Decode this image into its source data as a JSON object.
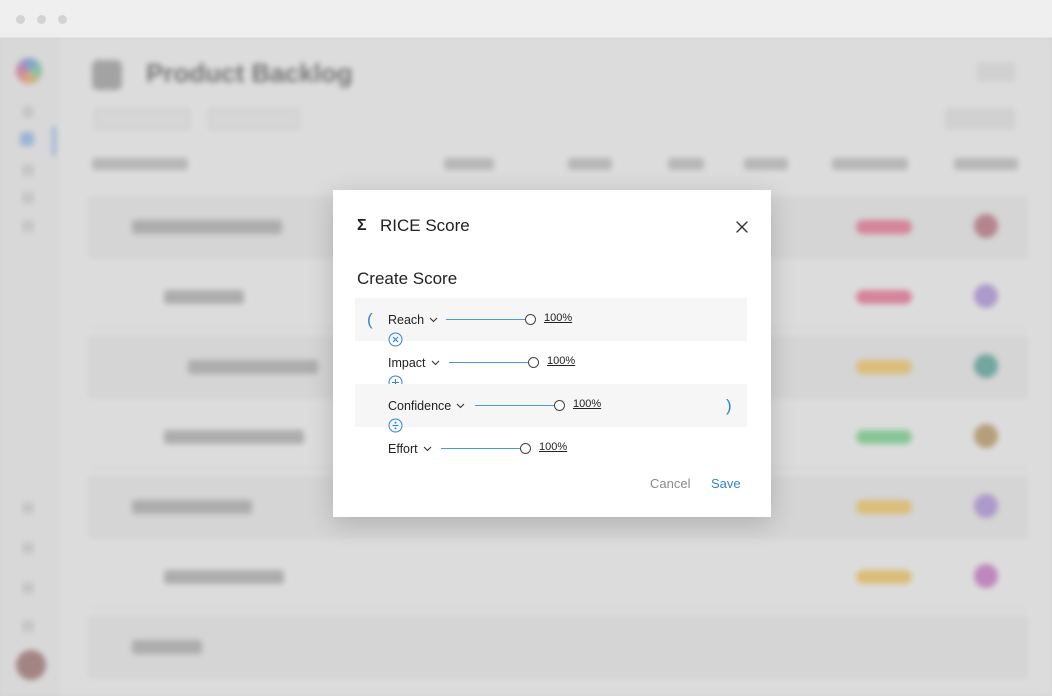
{
  "window": {
    "controls": [
      "close",
      "minimize",
      "maximize"
    ]
  },
  "background": {
    "page_title": "Product Backlog",
    "tag_colors": [
      "#e56b8c",
      "#e56b8c",
      "#efc25a",
      "#6fcf85",
      "#efc25a",
      "#efc25a"
    ],
    "avatar_colors": [
      "#b56b7a",
      "#a98bd6",
      "#4f9e95",
      "#b6925c",
      "#a98bd6",
      "#c46fc2"
    ]
  },
  "modal": {
    "icon": "sigma-icon",
    "title": "RICE Score",
    "section_title": "Create Score",
    "open_paren": "(",
    "close_paren": ")",
    "terms": [
      {
        "variable": "Reach",
        "value": "100%",
        "value_fraction": 1.0,
        "operator_icon": "multiply-icon"
      },
      {
        "variable": "Impact",
        "value": "100%",
        "value_fraction": 1.0,
        "operator_icon": "plus-icon"
      },
      {
        "variable": "Confidence",
        "value": "100%",
        "value_fraction": 1.0,
        "operator_icon": "divide-icon"
      },
      {
        "variable": "Effort",
        "value": "100%",
        "value_fraction": 1.0,
        "operator_icon": null
      }
    ],
    "cancel_label": "Cancel",
    "save_label": "Save",
    "accent_color": "#2f86d6"
  }
}
